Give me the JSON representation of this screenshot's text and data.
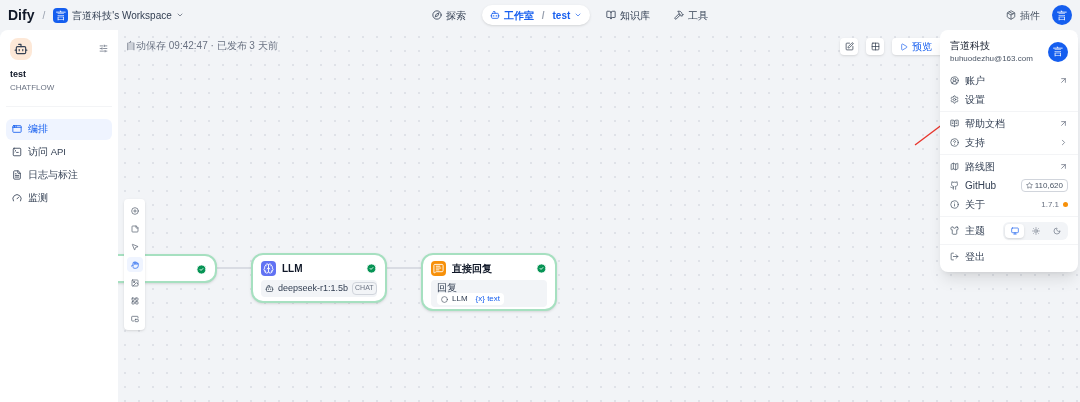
{
  "header": {
    "logo": "Dify",
    "separator": "/",
    "workspace": {
      "avatar": "言",
      "name": "言道科技's Workspace"
    },
    "nav": [
      {
        "kind": "explore",
        "label": "探索",
        "selected": false
      },
      {
        "kind": "studio",
        "label": "工作室",
        "selected": true,
        "separator": "/",
        "app": "test"
      },
      {
        "kind": "datasets",
        "label": "知识库",
        "selected": false
      },
      {
        "kind": "tools",
        "label": "工具",
        "selected": false
      }
    ],
    "plugins": "插件",
    "avatar": "言"
  },
  "sidebar": {
    "app_name": "test",
    "app_type": "CHATFLOW",
    "items": [
      {
        "kind": "orchestrate",
        "label": "编排",
        "selected": true
      },
      {
        "kind": "api",
        "label": "访问 API",
        "selected": false
      },
      {
        "kind": "logs",
        "label": "日志与标注",
        "selected": false
      },
      {
        "kind": "monitor",
        "label": "监测",
        "selected": false
      }
    ]
  },
  "canvas": {
    "status": "自动保存 09:42:47 · 已发布 3 天前",
    "preview": "预览",
    "tools": [
      {
        "kind": "add",
        "selected": false
      },
      {
        "kind": "note",
        "selected": false
      },
      {
        "kind": "pointer",
        "selected": false
      },
      {
        "kind": "hand",
        "selected": true
      },
      {
        "kind": "image",
        "selected": false
      },
      {
        "kind": "layout",
        "selected": false
      },
      {
        "kind": "minimap",
        "selected": false
      }
    ],
    "nodes": [
      {
        "kind": "start"
      },
      {
        "kind": "llm",
        "title": "LLM",
        "model": "deepseek-r1:1.5b",
        "mode": "CHAT"
      },
      {
        "kind": "answer",
        "title": "直接回复",
        "field_label": "回复",
        "source": "LLM",
        "variable": "{x} text"
      }
    ]
  },
  "account_menu": {
    "name": "言道科技",
    "email": "buhuodezhu@163.com",
    "avatar": "言",
    "groups": [
      [
        {
          "kind": "account",
          "label": "账户",
          "trailing": {
            "kind": "external"
          }
        },
        {
          "kind": "settings",
          "label": "设置"
        }
      ],
      [
        {
          "kind": "docs",
          "label": "帮助文档",
          "trailing": {
            "kind": "external"
          }
        },
        {
          "kind": "support",
          "label": "支持",
          "trailing": {
            "kind": "chevron"
          }
        }
      ],
      [
        {
          "kind": "roadmap",
          "label": "路线图",
          "trailing": {
            "kind": "external"
          }
        },
        {
          "kind": "github",
          "label": "GitHub",
          "trailing": {
            "kind": "stars",
            "value": "110,620"
          }
        },
        {
          "kind": "about",
          "label": "关于",
          "trailing": {
            "kind": "version",
            "value": "1.7.1",
            "color": "#f79009"
          }
        }
      ],
      [
        {
          "kind": "theme",
          "label": "主题",
          "trailing": {
            "kind": "theme",
            "options": [
              {
                "kind": "system",
                "selected": true
              },
              {
                "kind": "light",
                "selected": false
              },
              {
                "kind": "dark",
                "selected": false
              }
            ]
          }
        }
      ],
      [
        {
          "kind": "logout",
          "label": "登出"
        }
      ]
    ]
  }
}
